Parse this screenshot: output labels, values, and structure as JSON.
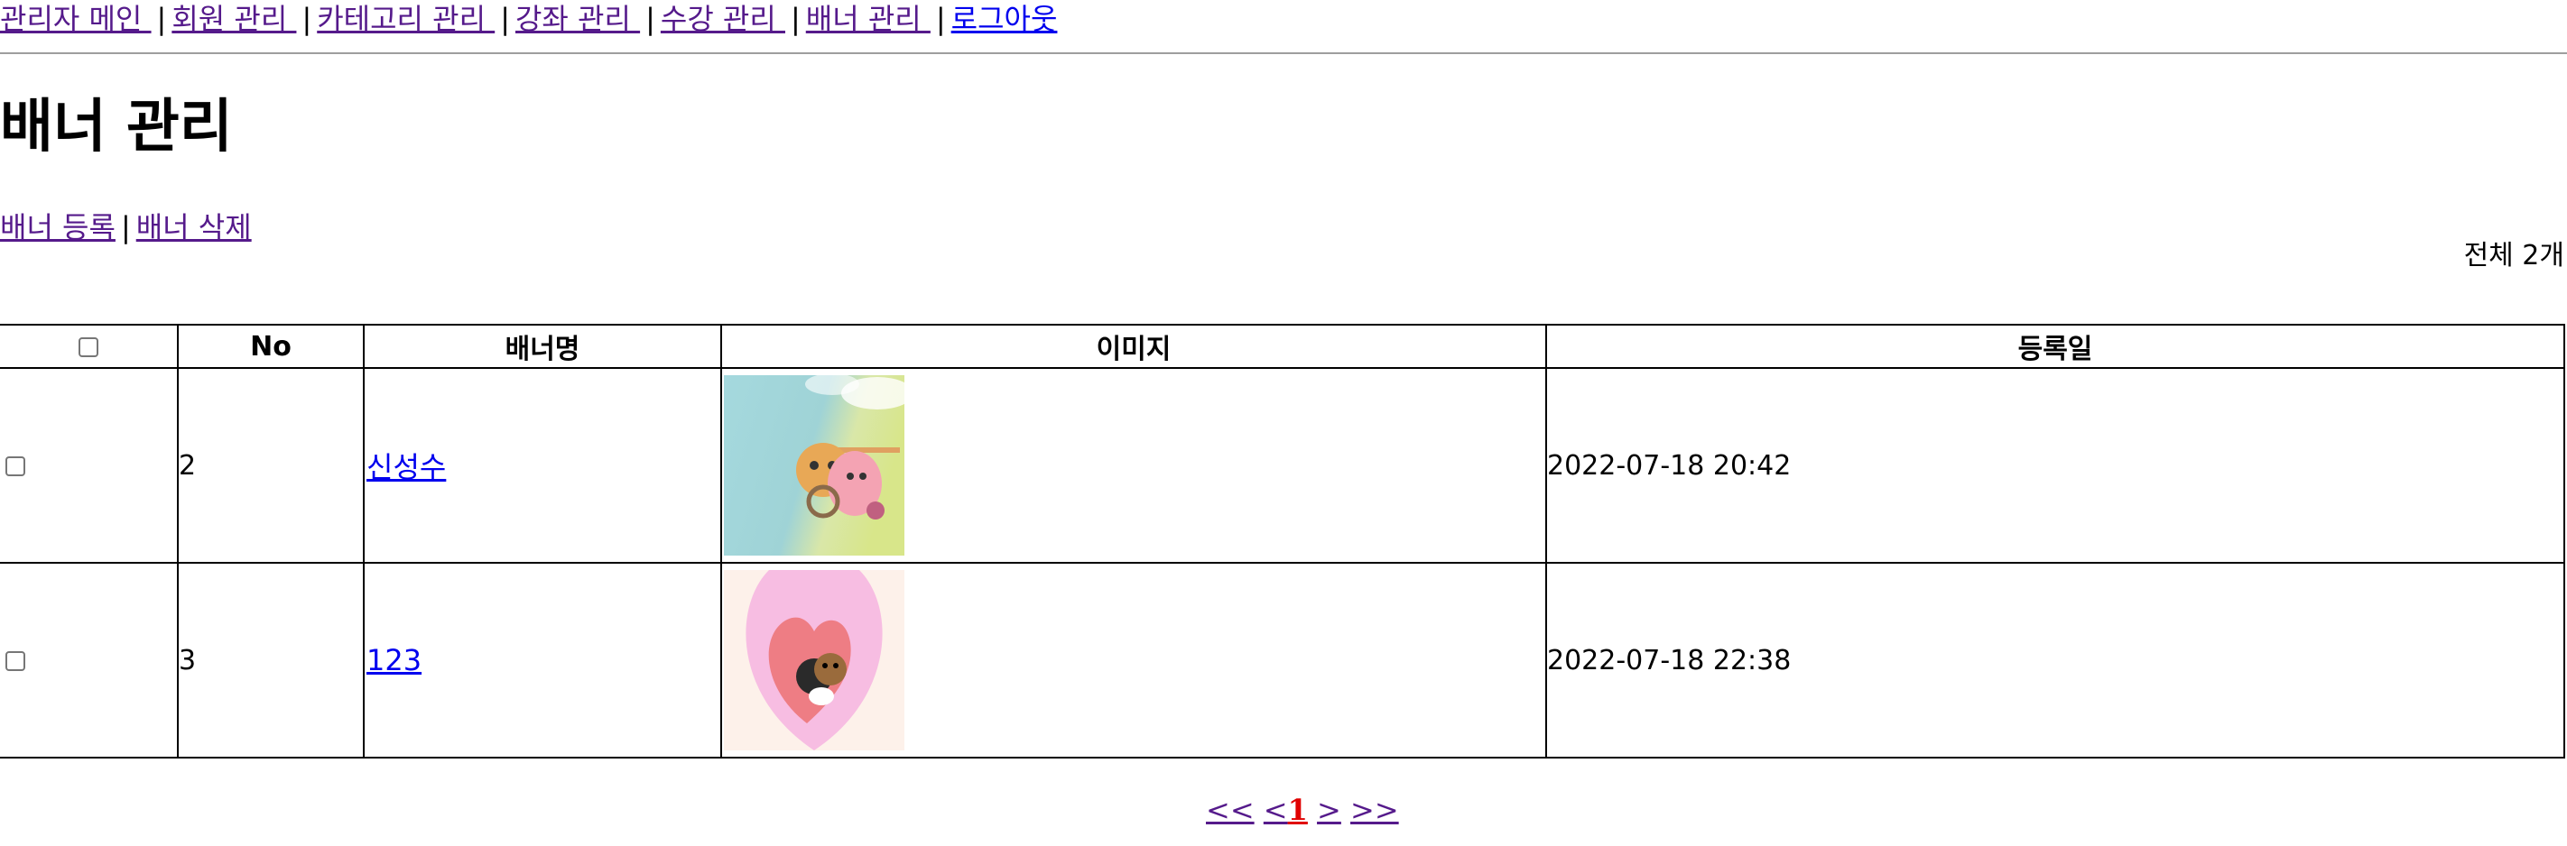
{
  "nav": {
    "items": [
      {
        "label": "관리자 메인 "
      },
      {
        "label": "회원 관리 "
      },
      {
        "label": "카테고리 관리 "
      },
      {
        "label": "강좌 관리 "
      },
      {
        "label": "수강 관리 "
      },
      {
        "label": "배너 관리 "
      },
      {
        "label": "로그아웃"
      }
    ],
    "separator": "|"
  },
  "page": {
    "title": "배너 관리",
    "actions": {
      "register": "배너 등록",
      "delete": "배너 삭제",
      "separator": "|"
    },
    "total": "전체 2개"
  },
  "table": {
    "headers": {
      "no": "No",
      "name": "배너명",
      "image": "이미지",
      "date": "등록일"
    },
    "rows": [
      {
        "no": "2",
        "name": "신성수",
        "image_icon": "banner-thumbnail-kakao-friends-field",
        "date": "2022-07-18 20:42"
      },
      {
        "no": "3",
        "name": "123",
        "image_icon": "banner-thumbnail-kakao-friends-heart",
        "date": "2022-07-18 22:38"
      }
    ]
  },
  "pagination": {
    "first": "<<",
    "prev": "<",
    "current": "1",
    "next": ">",
    "last": ">>"
  }
}
